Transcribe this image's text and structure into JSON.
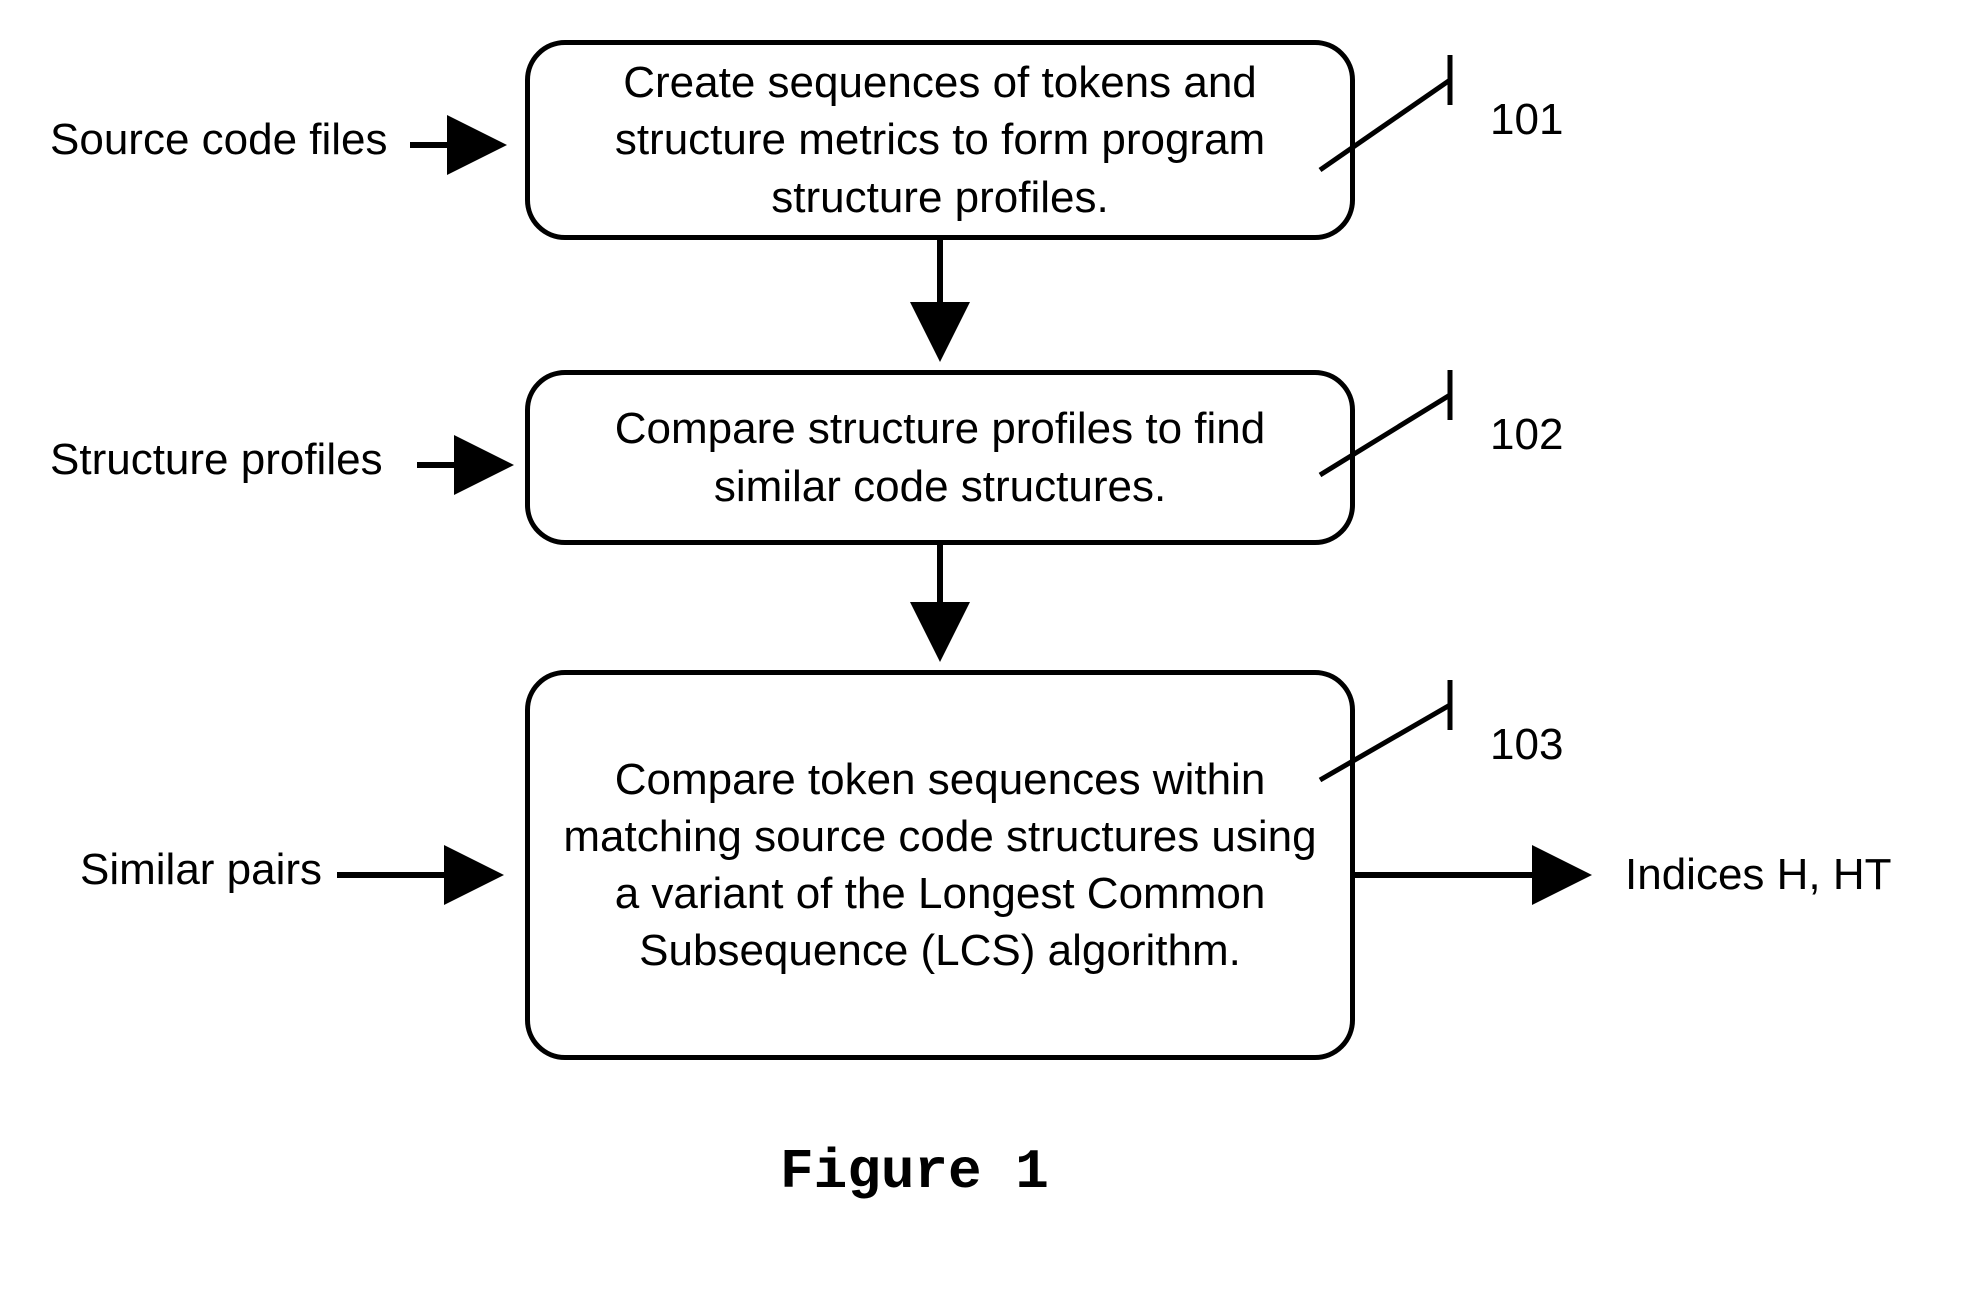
{
  "inputs": {
    "label1": "Source code files",
    "label2": "Structure profiles",
    "label3": "Similar pairs"
  },
  "steps": {
    "box1": "Create sequences of tokens and structure metrics to form program structure profiles.",
    "box2": "Compare structure profiles to find similar code structures.",
    "box3": "Compare token sequences within matching source code structures using a variant of the Longest Common Subsequence (LCS) algorithm."
  },
  "refs": {
    "r1": "101",
    "r2": "102",
    "r3": "103"
  },
  "output": {
    "label": "Indices H, HT"
  },
  "figure": {
    "title": "Figure 1"
  }
}
